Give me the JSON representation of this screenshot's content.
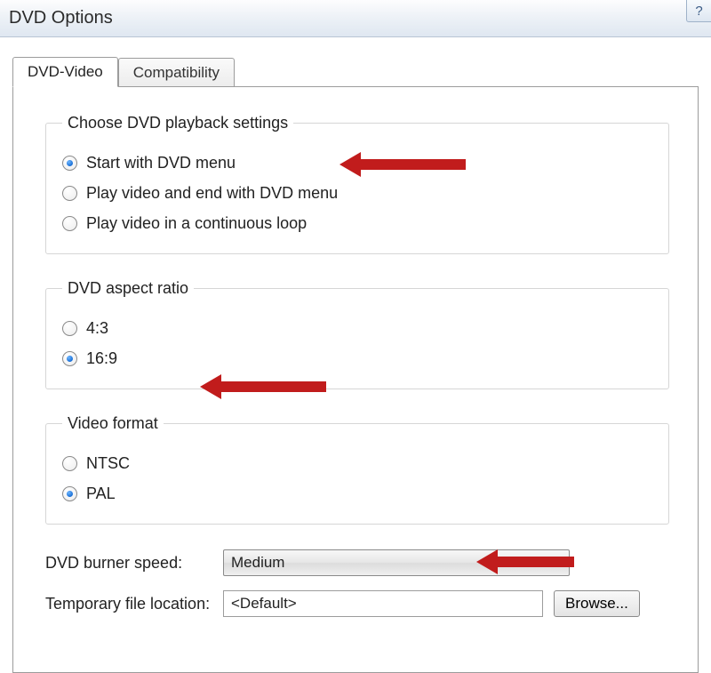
{
  "window": {
    "title": "DVD Options",
    "help_tooltip": "?"
  },
  "tabs": {
    "active": "DVD-Video",
    "inactive": "Compatibility"
  },
  "playback": {
    "legend": "Choose DVD playback settings",
    "opt1": "Start with DVD menu",
    "opt2": "Play video and end with DVD menu",
    "opt3": "Play video in a continuous loop"
  },
  "aspect": {
    "legend": "DVD aspect ratio",
    "opt1": "4:3",
    "opt2": "16:9"
  },
  "format": {
    "legend": "Video format",
    "opt1": "NTSC",
    "opt2": "PAL"
  },
  "burner": {
    "label": "DVD burner speed:",
    "value": "Medium"
  },
  "templocation": {
    "label": "Temporary file location:",
    "value": "<Default>",
    "browse": "Browse..."
  }
}
